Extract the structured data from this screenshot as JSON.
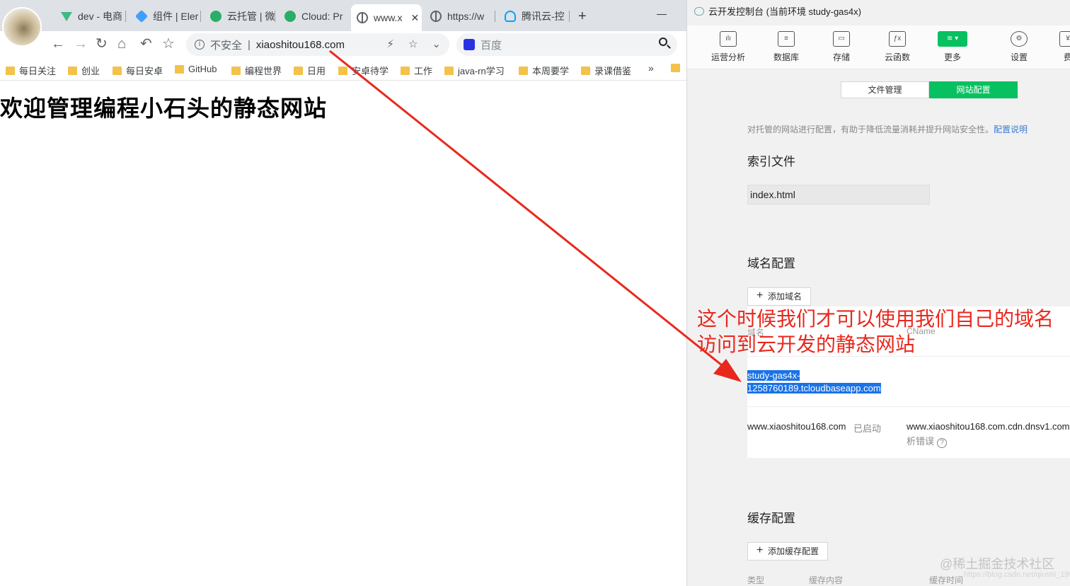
{
  "browser": {
    "tabs": [
      {
        "label": "dev - 电商",
        "icon": "vue-icon"
      },
      {
        "label": "组件 | Eler",
        "icon": "element-icon"
      },
      {
        "label": "云托管 | 微",
        "icon": "wechat-icon"
      },
      {
        "label": "Cloud: Pr",
        "icon": "wechat-icon"
      },
      {
        "label": "www.x",
        "icon": "globe-icon",
        "active": true
      },
      {
        "label": "https://w",
        "icon": "globe-icon"
      },
      {
        "label": "腾讯云-控",
        "icon": "tencent-cloud-icon"
      }
    ],
    "tab_close": "✕",
    "new_tab": "+",
    "address": {
      "security_label": "不安全",
      "separator": "|",
      "url": "xiaoshitou168.com"
    },
    "search": {
      "placeholder": "百度"
    },
    "bookmarks": [
      "每日关注",
      "创业",
      "每日安卓",
      "GitHub",
      "编程世界",
      "日用",
      "安卓待学",
      "工作",
      "java-rn学习",
      "本周要学",
      "录课借鉴"
    ],
    "bookmarks_more": "»",
    "page": {
      "heading": "欢迎管理编程小石头的静态网站"
    }
  },
  "console": {
    "title": "云开发控制台 (当前环境 study-gas4x)",
    "toolbar": [
      {
        "label": "运营分析",
        "icon": "chart-icon"
      },
      {
        "label": "数据库",
        "icon": "database-icon"
      },
      {
        "label": "存储",
        "icon": "storage-icon"
      },
      {
        "label": "云函数",
        "icon": "function-icon"
      },
      {
        "label": "更多",
        "icon": "layers-icon",
        "active": true
      },
      {
        "label": "设置",
        "icon": "gear-icon"
      },
      {
        "label": "费",
        "icon": "fee-icon"
      }
    ],
    "tabs": [
      "文件管理",
      "网站配置"
    ],
    "active_tab": "网站配置",
    "description": "对托管的网站进行配置，有助于降低流量消耗并提升网站安全性。",
    "description_link": "配置说明",
    "index_section": {
      "title": "索引文件",
      "value": "index.html"
    },
    "domain_section": {
      "title": "域名配置",
      "add_button": "添加域名",
      "columns": [
        "域名",
        "CName"
      ],
      "default_domain": [
        "study-gas4x-",
        "1258760189.tcloudbaseapp.com"
      ],
      "custom_domain": {
        "domain": "www.xiaoshitou168.com",
        "status": "已启动",
        "cname": "www.xiaoshitou168.com.cdn.dnsv1.com",
        "note": "析错误",
        "help": "?"
      }
    },
    "cache_section": {
      "title": "缓存配置",
      "add_button": "添加缓存配置",
      "columns": [
        "类型",
        "缓存内容",
        "缓存时间"
      ]
    }
  },
  "annotation": [
    "这个时候我们才可以使用我们自己的域名",
    "访问到云开发的静态网站"
  ],
  "watermark": "@稀土掘金技术社区",
  "watermark_small": "https://blog.csdn.net/qiushi_1990",
  "colors": {
    "accent_green": "#07c160",
    "annotation_red": "#e8281e",
    "selection_blue": "#1a73e8"
  }
}
